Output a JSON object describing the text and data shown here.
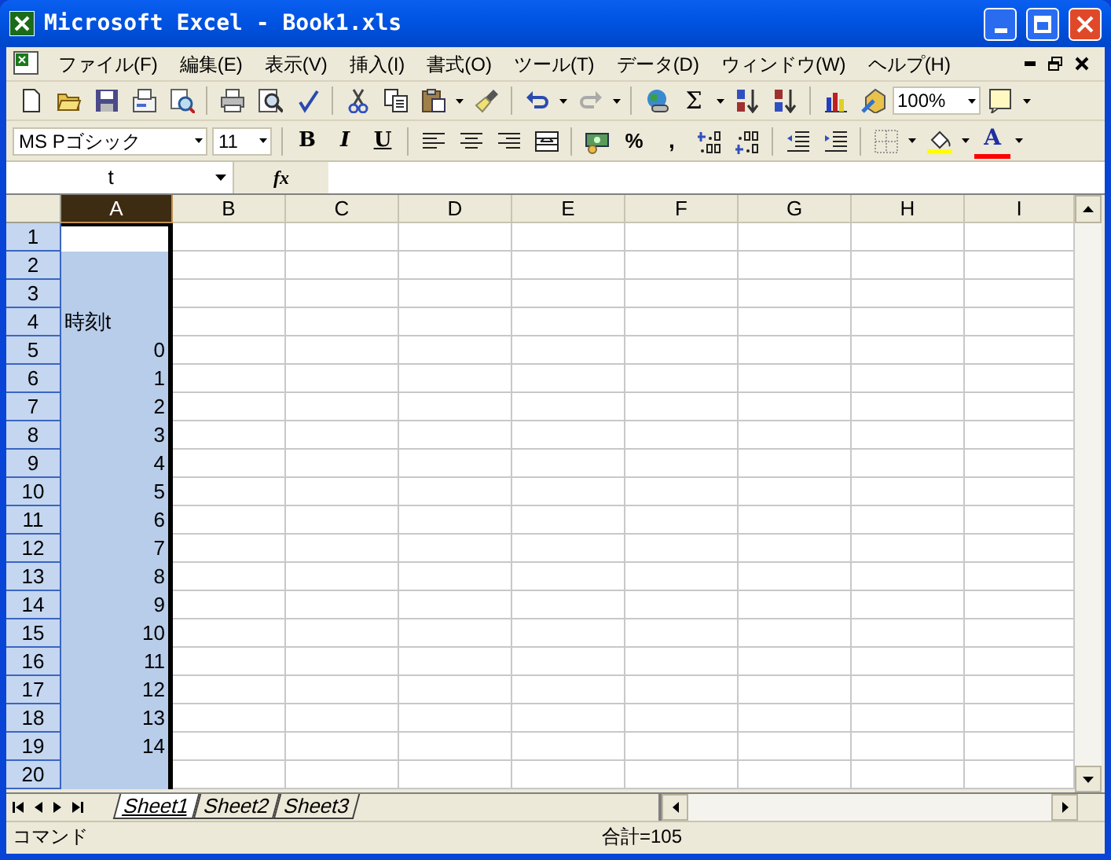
{
  "window": {
    "title": "Microsoft Excel - Book1.xls"
  },
  "menu": [
    {
      "label": "ファイル(F)"
    },
    {
      "label": "編集(E)"
    },
    {
      "label": "表示(V)"
    },
    {
      "label": "挿入(I)"
    },
    {
      "label": "書式(O)"
    },
    {
      "label": "ツール(T)"
    },
    {
      "label": "データ(D)"
    },
    {
      "label": "ウィンドウ(W)"
    },
    {
      "label": "ヘルプ(H)"
    }
  ],
  "standard_toolbar": {
    "autosum": "Σ",
    "zoom": "100%"
  },
  "formatting_toolbar": {
    "font": "MS Pゴシック",
    "size": "11",
    "bold": "B",
    "italic": "I",
    "underline": "U",
    "percent": "%",
    "comma": ",",
    "font_color": "A"
  },
  "formula_bar": {
    "name_box": "t",
    "fx": "fx"
  },
  "columns": [
    {
      "label": "A",
      "selected": true
    },
    {
      "label": "B",
      "selected": false
    },
    {
      "label": "C",
      "selected": false
    },
    {
      "label": "D",
      "selected": false
    },
    {
      "label": "E",
      "selected": false
    },
    {
      "label": "F",
      "selected": false
    },
    {
      "label": "G",
      "selected": false
    },
    {
      "label": "H",
      "selected": false
    },
    {
      "label": "I",
      "selected": false
    }
  ],
  "rows": [
    {
      "header": "1",
      "selected": true,
      "active": true
    },
    {
      "header": "2",
      "selected": true,
      "active": false
    },
    {
      "header": "3",
      "selected": true,
      "active": false
    },
    {
      "header": "4",
      "selected": true,
      "active": false,
      "cell_a": {
        "value": "時刻t",
        "kind": "text"
      }
    },
    {
      "header": "5",
      "selected": true,
      "active": false,
      "cell_a": {
        "value": "0",
        "kind": "number"
      }
    },
    {
      "header": "6",
      "selected": true,
      "active": false,
      "cell_a": {
        "value": "1",
        "kind": "number"
      }
    },
    {
      "header": "7",
      "selected": true,
      "active": false,
      "cell_a": {
        "value": "2",
        "kind": "number"
      }
    },
    {
      "header": "8",
      "selected": true,
      "active": false,
      "cell_a": {
        "value": "3",
        "kind": "number"
      }
    },
    {
      "header": "9",
      "selected": true,
      "active": false,
      "cell_a": {
        "value": "4",
        "kind": "number"
      }
    },
    {
      "header": "10",
      "selected": true,
      "active": false,
      "cell_a": {
        "value": "5",
        "kind": "number"
      }
    },
    {
      "header": "11",
      "selected": true,
      "active": false,
      "cell_a": {
        "value": "6",
        "kind": "number"
      }
    },
    {
      "header": "12",
      "selected": true,
      "active": false,
      "cell_a": {
        "value": "7",
        "kind": "number"
      }
    },
    {
      "header": "13",
      "selected": true,
      "active": false,
      "cell_a": {
        "value": "8",
        "kind": "number"
      }
    },
    {
      "header": "14",
      "selected": true,
      "active": false,
      "cell_a": {
        "value": "9",
        "kind": "number"
      }
    },
    {
      "header": "15",
      "selected": true,
      "active": false,
      "cell_a": {
        "value": "10",
        "kind": "number"
      }
    },
    {
      "header": "16",
      "selected": true,
      "active": false,
      "cell_a": {
        "value": "11",
        "kind": "number"
      }
    },
    {
      "header": "17",
      "selected": true,
      "active": false,
      "cell_a": {
        "value": "12",
        "kind": "number"
      }
    },
    {
      "header": "18",
      "selected": true,
      "active": false,
      "cell_a": {
        "value": "13",
        "kind": "number"
      }
    },
    {
      "header": "19",
      "selected": true,
      "active": false,
      "cell_a": {
        "value": "14",
        "kind": "number"
      }
    },
    {
      "header": "20",
      "selected": true,
      "active": false
    }
  ],
  "sheet_tabs": [
    {
      "label": "Sheet1",
      "selected": true
    },
    {
      "label": "Sheet2",
      "selected": false
    },
    {
      "label": "Sheet3",
      "selected": false
    }
  ],
  "status_bar": {
    "mode": "コマンド",
    "sum": "合計=105"
  }
}
